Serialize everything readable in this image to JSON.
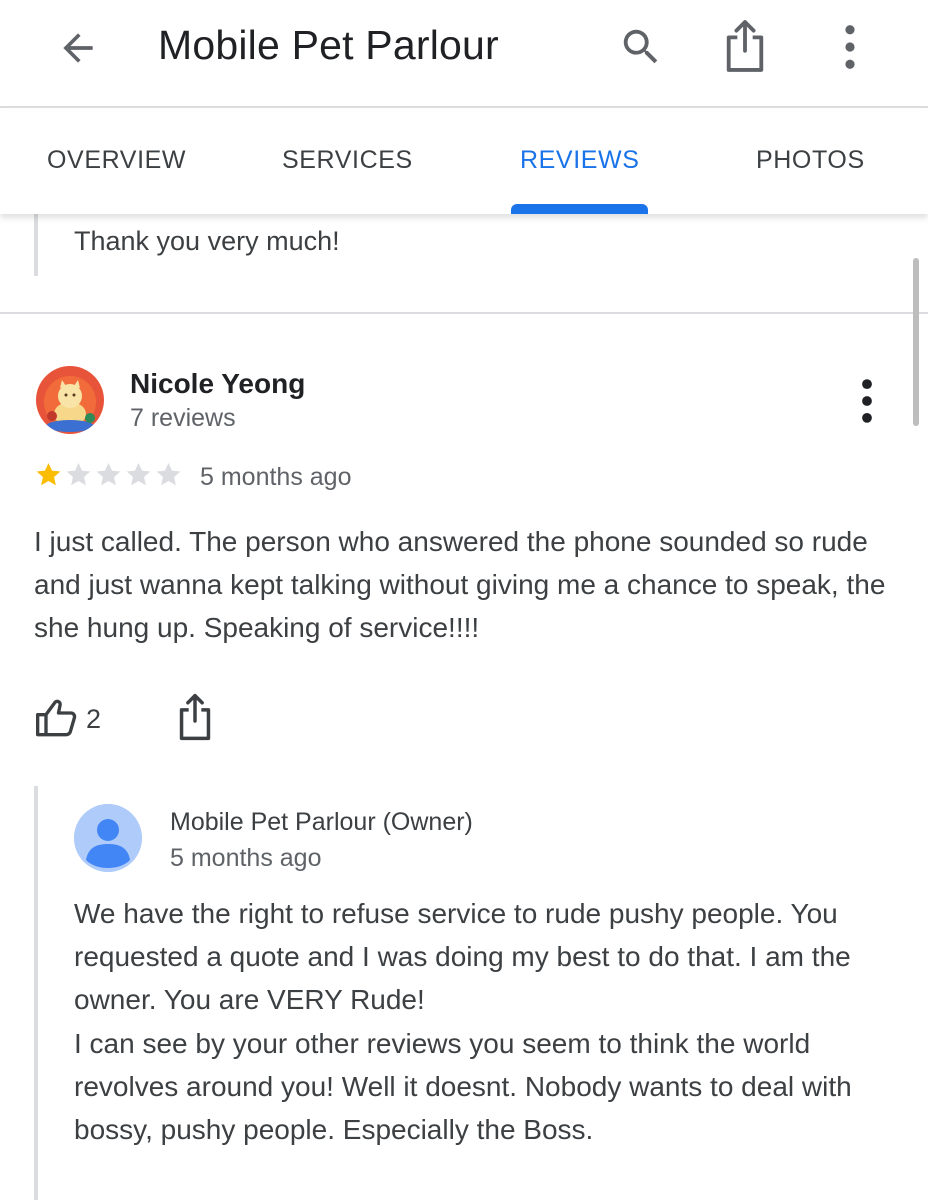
{
  "appbar": {
    "title": "Mobile Pet Parlour",
    "icons": [
      "arrow-back-icon",
      "search-icon",
      "share-icon",
      "more-vert-icon"
    ]
  },
  "tabs": [
    {
      "label": "OVERVIEW",
      "active": false
    },
    {
      "label": "SERVICES",
      "active": false
    },
    {
      "label": "REVIEWS",
      "active": true
    },
    {
      "label": "PHOTOS",
      "active": false
    }
  ],
  "previous_reply": {
    "text": "Thank you very much!"
  },
  "review": {
    "author": "Nicole Yeong",
    "review_count": "7 reviews",
    "rating": 1,
    "max_rating": 5,
    "time": "5 months ago",
    "text": "I just called. The person who answered the phone sounded so rude and just wanna kept talking without giving me a chance to speak, the she hung up. Speaking of service!!!!",
    "likes": "2"
  },
  "owner_response": {
    "name": "Mobile Pet Parlour (Owner)",
    "time": "5 months ago",
    "lines": [
      "We have the right to refuse service to rude pushy people. You requested a quote and I was doing my best to do that. I am the owner. You are VERY Rude!",
      "I can see by your other reviews you seem to think the world revolves around you! Well it doesnt. Nobody wants to deal with bossy, pushy people. Especially the Boss."
    ]
  },
  "colors": {
    "accent": "#1a73e8",
    "star_filled": "#fbbc04",
    "star_empty": "#dadce0",
    "text_primary": "#202124",
    "text_secondary": "#5f6368"
  }
}
